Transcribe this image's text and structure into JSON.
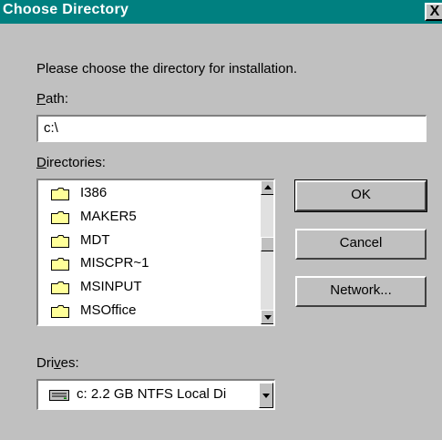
{
  "dialog": {
    "title": "Choose Directory",
    "close_label": "X",
    "prompt": "Please choose the directory for installation."
  },
  "path": {
    "label_first": "P",
    "label_rest": "ath:",
    "value": "c:\\"
  },
  "directories": {
    "label_first": "D",
    "label_rest": "irectories:",
    "items": [
      "I386",
      "MAKER5",
      "MDT",
      "MISCPR~1",
      "MSINPUT",
      "MSOffice"
    ]
  },
  "buttons": {
    "ok": "OK",
    "cancel": "Cancel",
    "network": "Network..."
  },
  "drives": {
    "label_start": "Dri",
    "label_u": "v",
    "label_end": "es:",
    "value": "c: 2.2 GB NTFS Local Di"
  },
  "colors": {
    "titlebar": "#008080",
    "face": "#c0c0c0",
    "folder": "#ffff99"
  }
}
